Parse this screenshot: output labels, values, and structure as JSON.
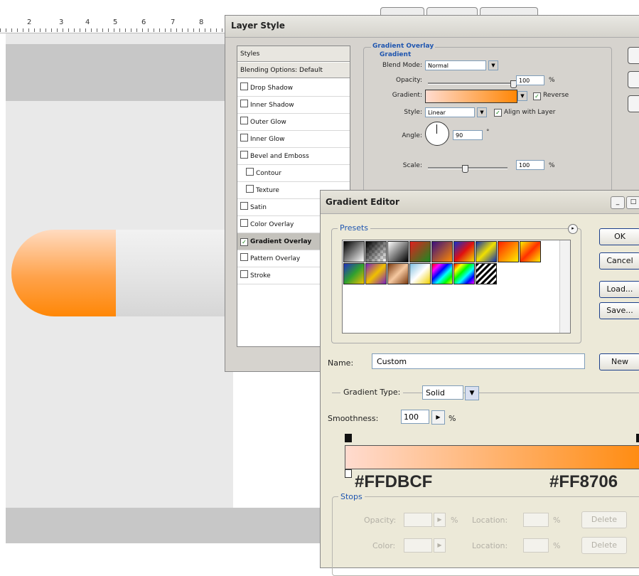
{
  "canvas": {
    "ruler_numbers": [
      "2",
      "3",
      "4",
      "5",
      "6",
      "7",
      "8"
    ],
    "capsule_colors": {
      "orange": "#FF8706",
      "light": "#FFDBCF",
      "gray": "#E4E4E4"
    }
  },
  "layer_style": {
    "title": "Layer Style",
    "styles_header": "Styles",
    "blending_options": "Blending Options: Default",
    "effects": [
      {
        "label": "Drop Shadow",
        "checked": false
      },
      {
        "label": "Inner Shadow",
        "checked": false
      },
      {
        "label": "Outer Glow",
        "checked": false
      },
      {
        "label": "Inner Glow",
        "checked": false
      },
      {
        "label": "Bevel and Emboss",
        "checked": false
      },
      {
        "label": "Contour",
        "checked": false
      },
      {
        "label": "Texture",
        "checked": false
      },
      {
        "label": "Satin",
        "checked": false
      },
      {
        "label": "Color Overlay",
        "checked": false
      },
      {
        "label": "Gradient Overlay",
        "checked": true
      },
      {
        "label": "Pattern Overlay",
        "checked": false
      },
      {
        "label": "Stroke",
        "checked": false
      }
    ],
    "gradient_overlay": {
      "group_title": "Gradient Overlay",
      "sub_title": "Gradient",
      "blend_mode_label": "Blend Mode:",
      "blend_mode_value": "Normal",
      "opacity_label": "Opacity:",
      "opacity_value": "100",
      "opacity_unit": "%",
      "gradient_label": "Gradient:",
      "reverse_label": "Reverse",
      "style_label": "Style:",
      "style_value": "Linear",
      "align_label": "Align with Layer",
      "angle_label": "Angle:",
      "angle_value": "90",
      "angle_unit": "°",
      "scale_label": "Scale:",
      "scale_value": "100",
      "scale_unit": "%"
    }
  },
  "gradient_editor": {
    "title": "Gradient Editor",
    "presets_label": "Presets",
    "buttons": {
      "ok": "OK",
      "cancel": "Cancel",
      "load": "Load...",
      "save": "Save...",
      "new": "New"
    },
    "name_label": "Name:",
    "name_value": "Custom",
    "gradient_type_label": "Gradient Type:",
    "gradient_type_value": "Solid",
    "smoothness_label": "Smoothness:",
    "smoothness_value": "100",
    "smoothness_unit": "%",
    "left_color": "#FFDBCF",
    "right_color": "#FF8706",
    "right_color_visible": "#FF8706",
    "stops": {
      "legend": "Stops",
      "opacity_label": "Opacity:",
      "percent": "%",
      "location_label": "Location:",
      "delete_label": "Delete",
      "color_label": "Color:"
    }
  }
}
